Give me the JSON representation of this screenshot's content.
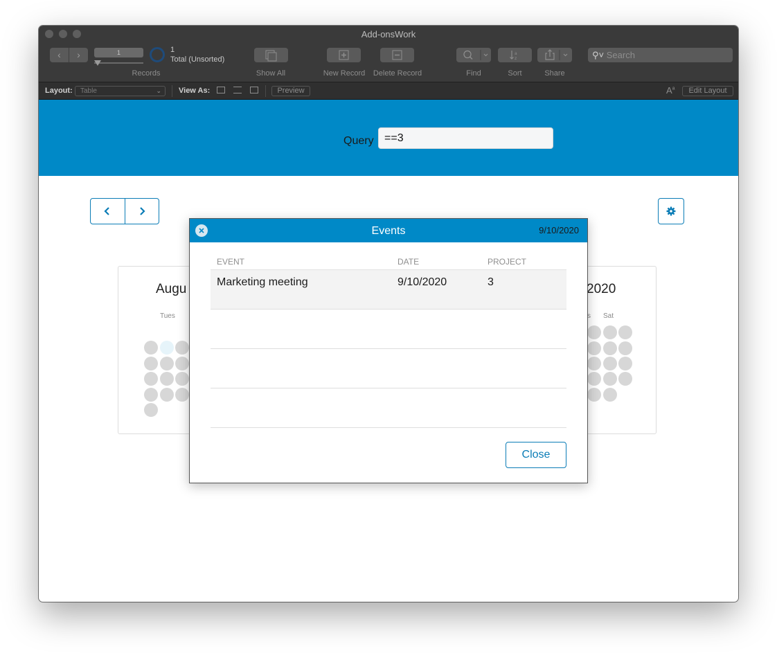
{
  "window": {
    "title": "Add-onsWork"
  },
  "toolbar": {
    "record_field": "1",
    "record_count": "1",
    "record_total": "Total (Unsorted)",
    "records_label": "Records",
    "show_all_label": "Show All",
    "new_record_label": "New Record",
    "delete_record_label": "Delete Record",
    "find_label": "Find",
    "sort_label": "Sort",
    "share_label": "Share",
    "search_placeholder": "Search"
  },
  "layoutbar": {
    "layout_label": "Layout:",
    "layout_value": "Table",
    "view_as_label": "View As:",
    "preview_label": "Preview",
    "edit_layout_label": "Edit Layout"
  },
  "banner": {
    "query_label": "Query",
    "query_value": "==3",
    "color": "#0089c7"
  },
  "calendar": {
    "month_left": "Augu",
    "month_right": "2020",
    "day_left": "Tues",
    "day_right_partial": "s",
    "day_right": "Sat"
  },
  "dialog": {
    "title": "Events",
    "date": "9/10/2020",
    "columns": [
      "EVENT",
      "DATE",
      "PROJECT"
    ],
    "rows": [
      {
        "event": "Marketing meeting",
        "date": "9/10/2020",
        "project": "3"
      }
    ],
    "close_label": "Close"
  }
}
